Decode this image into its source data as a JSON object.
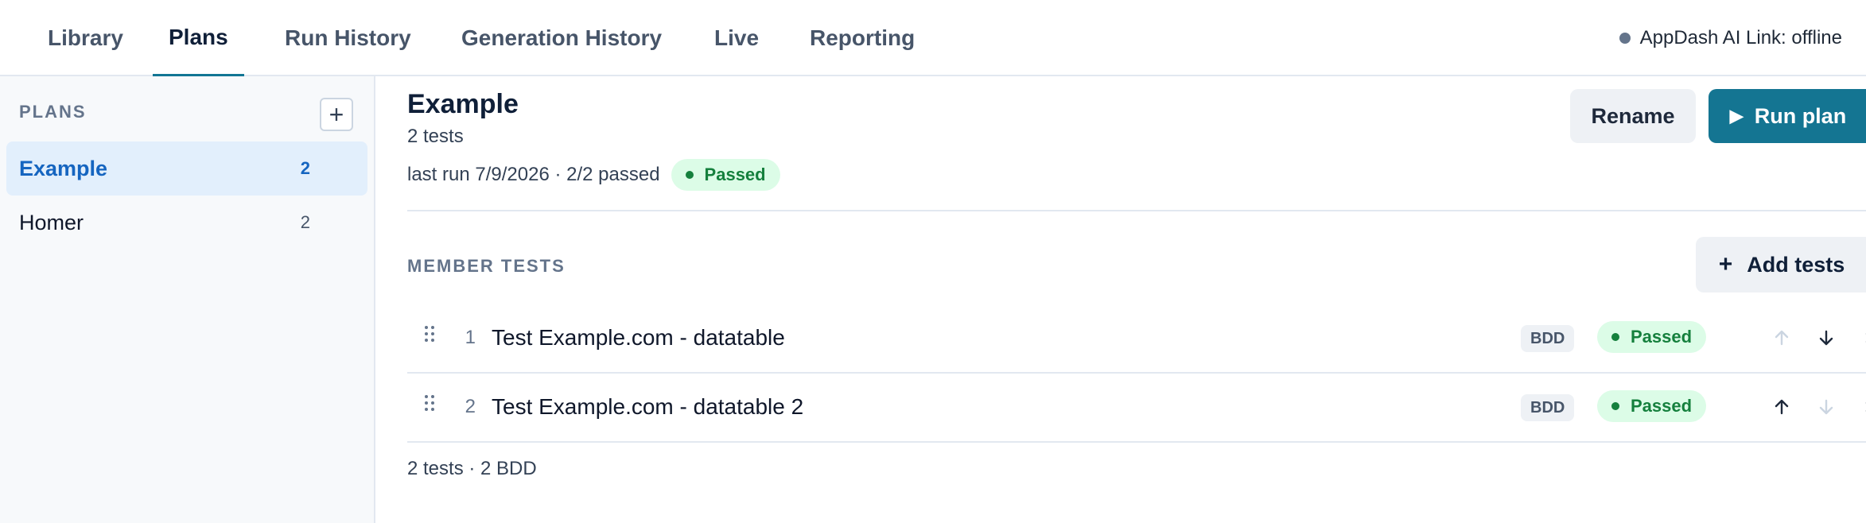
{
  "nav": {
    "tabs": [
      {
        "label": "Library"
      },
      {
        "label": "Plans"
      },
      {
        "label": "Run History"
      },
      {
        "label": "Generation History"
      },
      {
        "label": "Live"
      },
      {
        "label": "Reporting"
      }
    ],
    "active_tab": "Plans",
    "status_text": "AppDash AI Link: offline"
  },
  "sidebar": {
    "header": "PLANS",
    "add_button": "+",
    "plans": [
      {
        "name": "Example",
        "count": "2",
        "active": true
      },
      {
        "name": "Homer",
        "count": "2",
        "active": false
      }
    ]
  },
  "plan": {
    "title": "Example",
    "subtitle": "2 tests",
    "last_run": "last run 7/9/2026 · 2/2 passed",
    "status": "Passed",
    "rename_label": "Rename",
    "run_label": "Run plan"
  },
  "member_tests": {
    "header": "MEMBER TESTS",
    "add_label": "Add tests",
    "rows": [
      {
        "index": "1",
        "name": "Test Example.com - datatable",
        "type": "BDD",
        "status": "Passed",
        "up_enabled": false,
        "down_enabled": true
      },
      {
        "index": "2",
        "name": "Test Example.com - datatable 2",
        "type": "BDD",
        "status": "Passed",
        "up_enabled": true,
        "down_enabled": false
      }
    ],
    "summary": "2 tests · 2 BDD"
  },
  "colors": {
    "accent": "#147592",
    "active_blue": "#1565c0",
    "passed_bg": "#dcfce7",
    "passed_text": "#15803d"
  }
}
